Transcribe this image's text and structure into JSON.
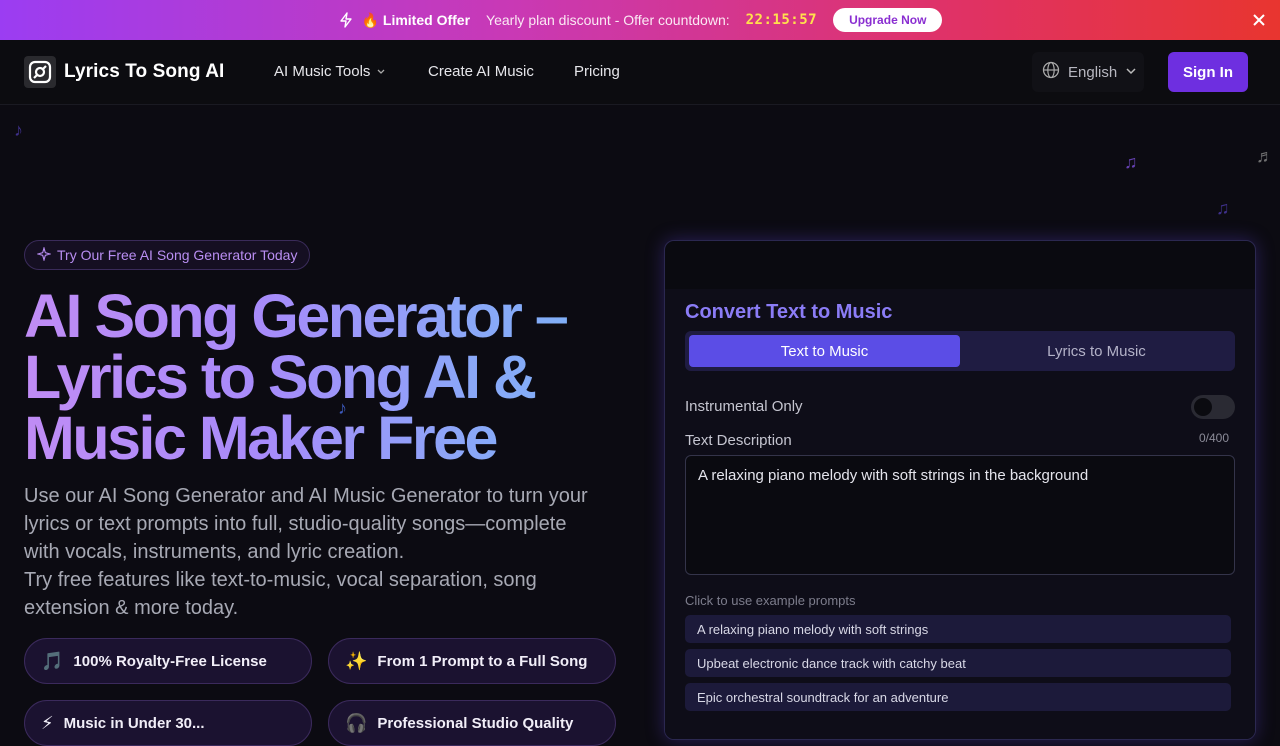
{
  "promo": {
    "offer_label": "🔥 Limited Offer",
    "message": "Yearly plan discount - Offer countdown:",
    "countdown": "22:15:57",
    "cta": "Upgrade Now"
  },
  "nav": {
    "brand": "Lyrics To Song AI",
    "items": [
      "AI Music Tools",
      "Create AI Music",
      "Pricing"
    ],
    "language": "English",
    "signin": "Sign In"
  },
  "hero": {
    "badge": "Try Our Free AI Song Generator Today",
    "title_lines": [
      "AI Song Generator –",
      "Lyrics to Song AI &",
      "Music Maker Free"
    ],
    "description": [
      "Use our AI Song Generator and AI Music Generator to turn your lyrics or text prompts into full, studio-quality songs—complete with vocals, instruments, and lyric creation.",
      "Try free features like text-to-music, vocal separation, song extension & more today."
    ],
    "features": [
      {
        "icon": "🎵",
        "label": "100% Royalty-Free License"
      },
      {
        "icon": "✨",
        "label": "From 1 Prompt to a Full Song"
      },
      {
        "icon": "⚡",
        "label": "Music in Under 30..."
      },
      {
        "icon": "🎧",
        "label": "Professional Studio Quality"
      }
    ]
  },
  "card": {
    "title": "Convert Text to Music",
    "tabs": [
      "Text to Music",
      "Lyrics to Music"
    ],
    "instrumental_label": "Instrumental Only",
    "description_label": "Text Description",
    "counter": "0/400",
    "textarea_value": "A relaxing piano melody with soft strings in the background",
    "examples_hint": "Click to use example prompts",
    "examples": [
      "A relaxing piano melody with soft strings",
      "Upbeat electronic dance track with catchy beat",
      "Epic orchestral soundtrack for an adventure"
    ]
  },
  "colors": {
    "accent": "#6e2fe0",
    "tab_active": "#5b4de6",
    "card_title": "#8b7cf6",
    "countdown": "#ffe14d"
  }
}
